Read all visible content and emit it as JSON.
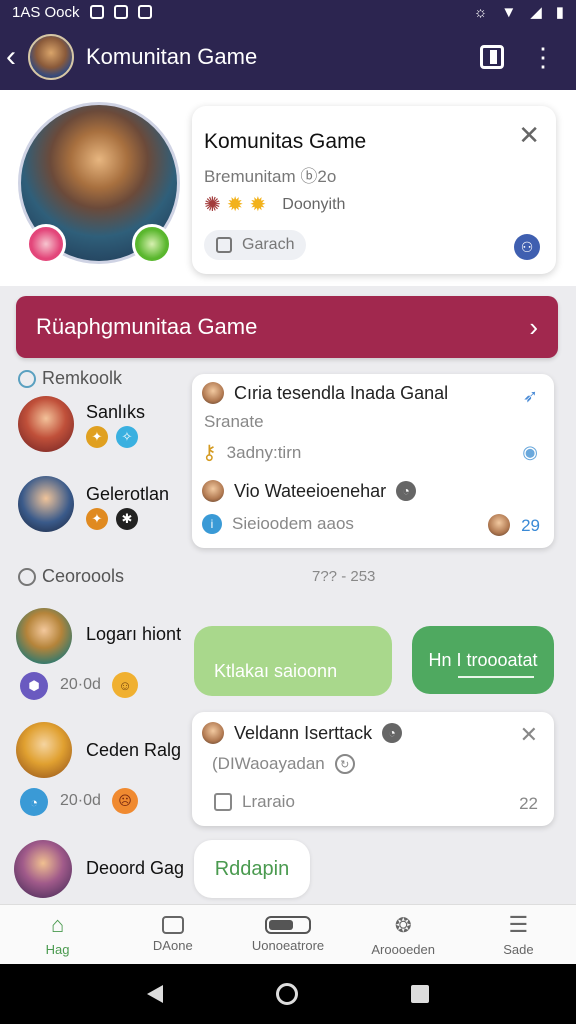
{
  "status_bar": {
    "time": "1AS Oock"
  },
  "header": {
    "title": "Komunitan Game"
  },
  "hero_card": {
    "title": "Komunitas Game",
    "subtitle": "Bremunitam ⓑ2o",
    "stars_label": "Doonyith",
    "pill_label": "Garach"
  },
  "banner": {
    "label": "Rüaphgmunitaa Game"
  },
  "sections": {
    "first": "Remkoolk",
    "second": "Ceoroools",
    "second_meta": "7?? - 253"
  },
  "users": [
    {
      "name": "Sanlıks"
    },
    {
      "name": "Gelerotlan"
    },
    {
      "name": "Logarı hiont",
      "meta": "20·0d"
    },
    {
      "name": "Ceden Ralg",
      "meta": "20·0d"
    },
    {
      "name": "Deoord Gag"
    }
  ],
  "card1": {
    "row1": "Cıria tesendla Inada Ganal",
    "row1_sub": "Sranate",
    "row2": "3adny:tirn",
    "row3": "Vio Wateeioenehar",
    "row4": "Sieioodem aaos",
    "count": "29"
  },
  "messages": {
    "light": "Ktlakaı saioonn",
    "dark": "Hn I troooatat",
    "white": "Rddapin"
  },
  "card2": {
    "row1": "Veldann Iserttack",
    "row2": "(DIWaoayadan",
    "row3": "Lraraio",
    "count": "22"
  },
  "bottom_nav": [
    {
      "label": "Hag"
    },
    {
      "label": "DAone"
    },
    {
      "label": "Uonoeatrore"
    },
    {
      "label": "Aroooeden"
    },
    {
      "label": "Sade"
    }
  ],
  "colors": {
    "primary": "#2c2550",
    "banner": "#a1284e",
    "green": "#4fa960",
    "light_green": "#a9d88c"
  }
}
